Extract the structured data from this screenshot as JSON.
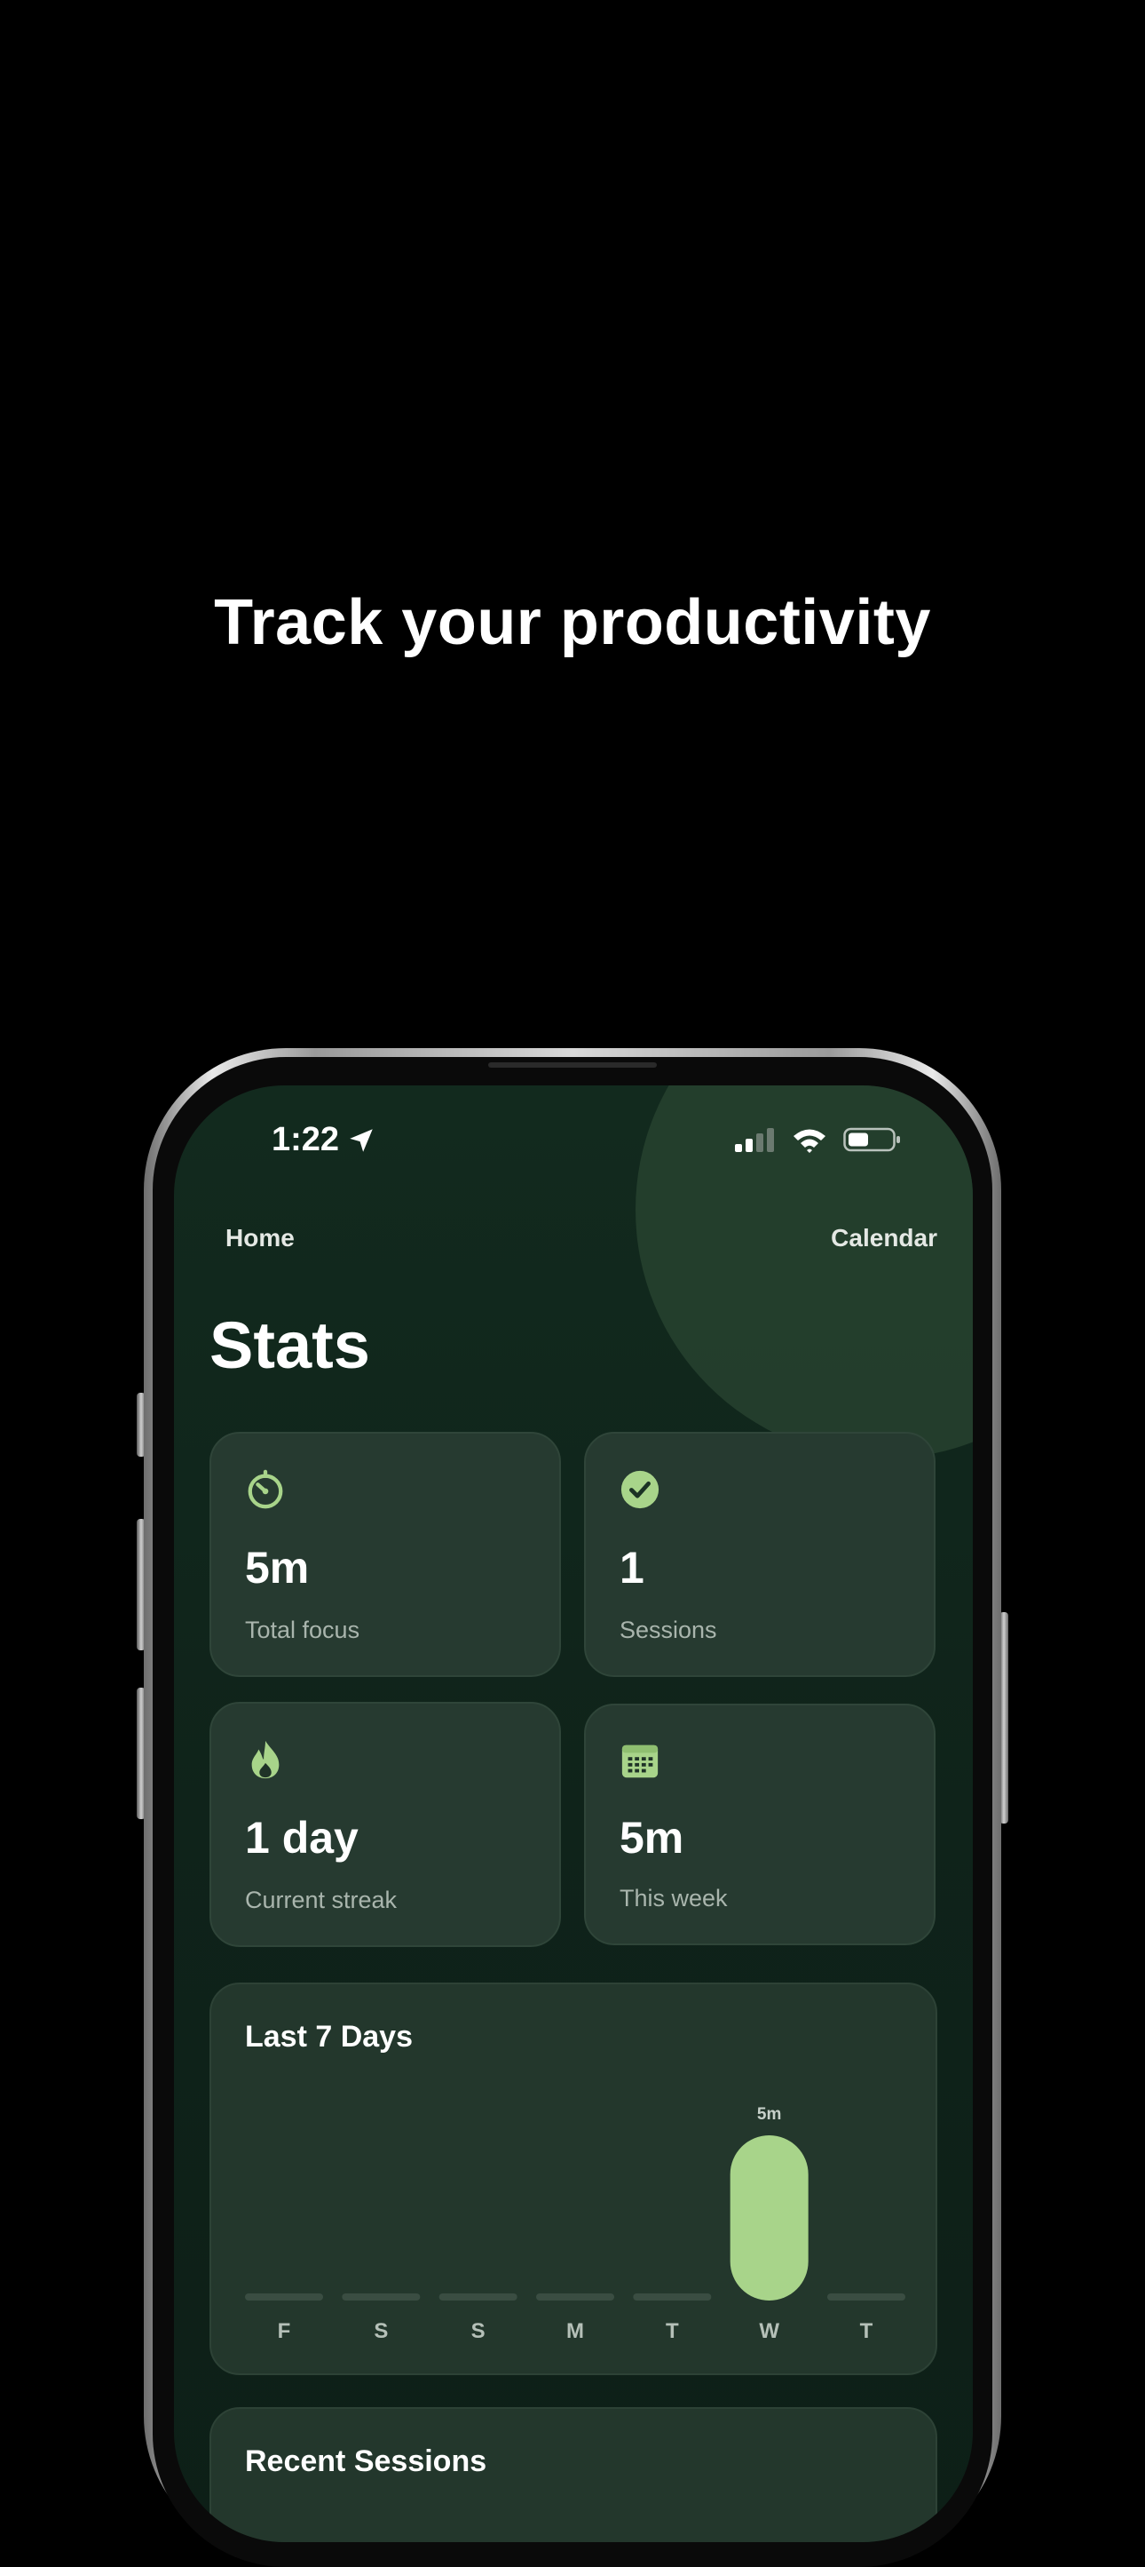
{
  "headline": "Track your productivity",
  "status": {
    "time": "1:22"
  },
  "nav": {
    "home": "Home",
    "calendar": "Calendar"
  },
  "title": "Stats",
  "cards": [
    {
      "icon": "timer-icon",
      "value": "5m",
      "label": "Total focus"
    },
    {
      "icon": "check-circle-icon",
      "value": "1",
      "label": "Sessions"
    },
    {
      "icon": "flame-icon",
      "value": "1 day",
      "label": "Current streak"
    },
    {
      "icon": "calendar-grid-icon",
      "value": "5m",
      "label": "This week"
    }
  ],
  "chart_data": {
    "type": "bar",
    "title": "Last 7 Days",
    "categories": [
      "F",
      "S",
      "S",
      "M",
      "T",
      "W",
      "T"
    ],
    "values": [
      0,
      0,
      0,
      0,
      0,
      5,
      0
    ],
    "data_labels": [
      "",
      "",
      "",
      "",
      "",
      "5m",
      ""
    ],
    "unit": "m"
  },
  "recent": {
    "title": "Recent Sessions"
  },
  "colors": {
    "accent": "#a8d48a",
    "track": "#3a4d42",
    "card": "#263a30",
    "screen_bg": "#122a1e"
  }
}
